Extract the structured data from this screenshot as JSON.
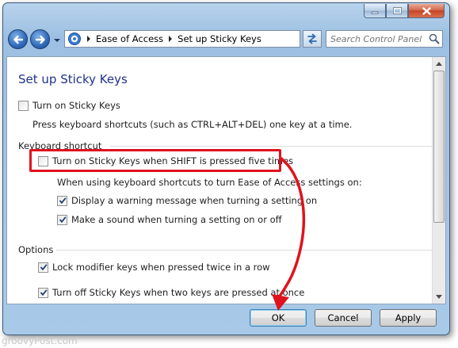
{
  "window": {
    "caption_buttons": [
      "minimize",
      "maximize",
      "close"
    ]
  },
  "address_bar": {
    "crumbs": [
      "Ease of Access",
      "Set up Sticky Keys"
    ],
    "search_placeholder": "Search Control Panel"
  },
  "content": {
    "title": "Set up Sticky Keys",
    "turn_on_sticky_keys": {
      "label": "Turn on Sticky Keys",
      "checked": false
    },
    "description": "Press keyboard shortcuts (such as CTRL+ALT+DEL) one key at a time.",
    "keyboard_shortcut": {
      "heading": "Keyboard shortcut",
      "shift_five_times": {
        "label": "Turn on Sticky Keys when SHIFT is pressed five times",
        "checked": false
      },
      "when_using": "When using keyboard shortcuts to turn Ease of Access settings on:",
      "display_warning": {
        "label": "Display a warning message when turning a setting on",
        "checked": true
      },
      "make_sound": {
        "label": "Make a sound when turning a setting on or off",
        "checked": true
      }
    },
    "options": {
      "heading": "Options",
      "lock_modifier": {
        "label": "Lock modifier keys when pressed twice in a row",
        "checked": true
      },
      "turn_off_two_keys": {
        "label": "Turn off Sticky Keys when two keys are pressed at once",
        "checked": true
      }
    }
  },
  "buttons": {
    "ok": "OK",
    "cancel": "Cancel",
    "apply": "Apply"
  },
  "annotation": {
    "highlight_color": "#e0121e"
  },
  "watermark": "groovyPost.com"
}
